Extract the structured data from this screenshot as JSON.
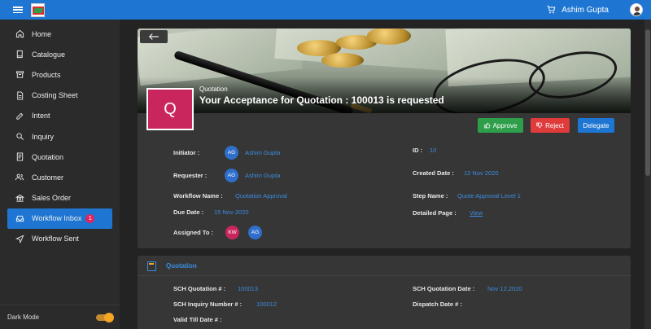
{
  "topbar": {
    "user_name": "Ashim Gupta"
  },
  "sidebar": {
    "items": [
      {
        "label": "Home",
        "icon": "home-icon"
      },
      {
        "label": "Catalogue",
        "icon": "book-icon"
      },
      {
        "label": "Products",
        "icon": "box-icon"
      },
      {
        "label": "Costing Sheet",
        "icon": "document-icon"
      },
      {
        "label": "Intent",
        "icon": "edit-icon"
      },
      {
        "label": "Inquiry",
        "icon": "search-icon"
      },
      {
        "label": "Quotation",
        "icon": "quotation-icon"
      },
      {
        "label": "Customer",
        "icon": "people-icon"
      },
      {
        "label": "Sales Order",
        "icon": "bank-icon"
      },
      {
        "label": "Workflow Inbox",
        "icon": "inbox-icon",
        "badge": "1",
        "active": true
      },
      {
        "label": "Workflow Sent",
        "icon": "send-icon"
      }
    ],
    "dark_mode_label": "Dark Mode",
    "dark_mode_on": true
  },
  "hero": {
    "badge_letter": "Q",
    "subtitle": "Quotation",
    "title": "Your Acceptance for Quotation : 100013 is requested"
  },
  "actions": {
    "approve": "Approve",
    "reject": "Reject",
    "delegate": "Delegate"
  },
  "details": {
    "initiator_label": "Initiator :",
    "initiator_initials": "AG",
    "initiator_name": "Ashim Gupta",
    "id_label": "ID :",
    "id_value": "10",
    "requester_label": "Requester :",
    "requester_initials": "AG",
    "requester_name": "Ashim Gupta",
    "created_label": "Created Date :",
    "created_value": "12 Nov 2020",
    "workflow_label": "Workflow Name :",
    "workflow_value": "Quotation Approval",
    "step_label": "Step Name :",
    "step_value": "Quote Approval Level 1",
    "due_label": "Due Date :",
    "due_value": "15 Nov 2020",
    "detailed_label": "Detailed Page :",
    "detailed_value": "View",
    "assigned_label": "Assigned To :",
    "assigned_chips": [
      "KW",
      "AG"
    ]
  },
  "quotation_section": {
    "title": "Quotation",
    "sch_quotation_label": "SCH Quotation # :",
    "sch_quotation_value": "100013",
    "sch_quotation_date_label": "SCH Quotation Date :",
    "sch_quotation_date_value": "Nov 12,2020",
    "sch_inquiry_label": "SCH Inquiry Number # :",
    "sch_inquiry_value": "100012",
    "dispatch_label": "Dispatch Date # :",
    "valid_till_label": "Valid Till Date # :"
  },
  "colors": {
    "primary": "#1e76d2",
    "approve": "#2e9e4a",
    "reject": "#e03b3b",
    "accent": "#c9265e",
    "link": "#3b8de0"
  }
}
